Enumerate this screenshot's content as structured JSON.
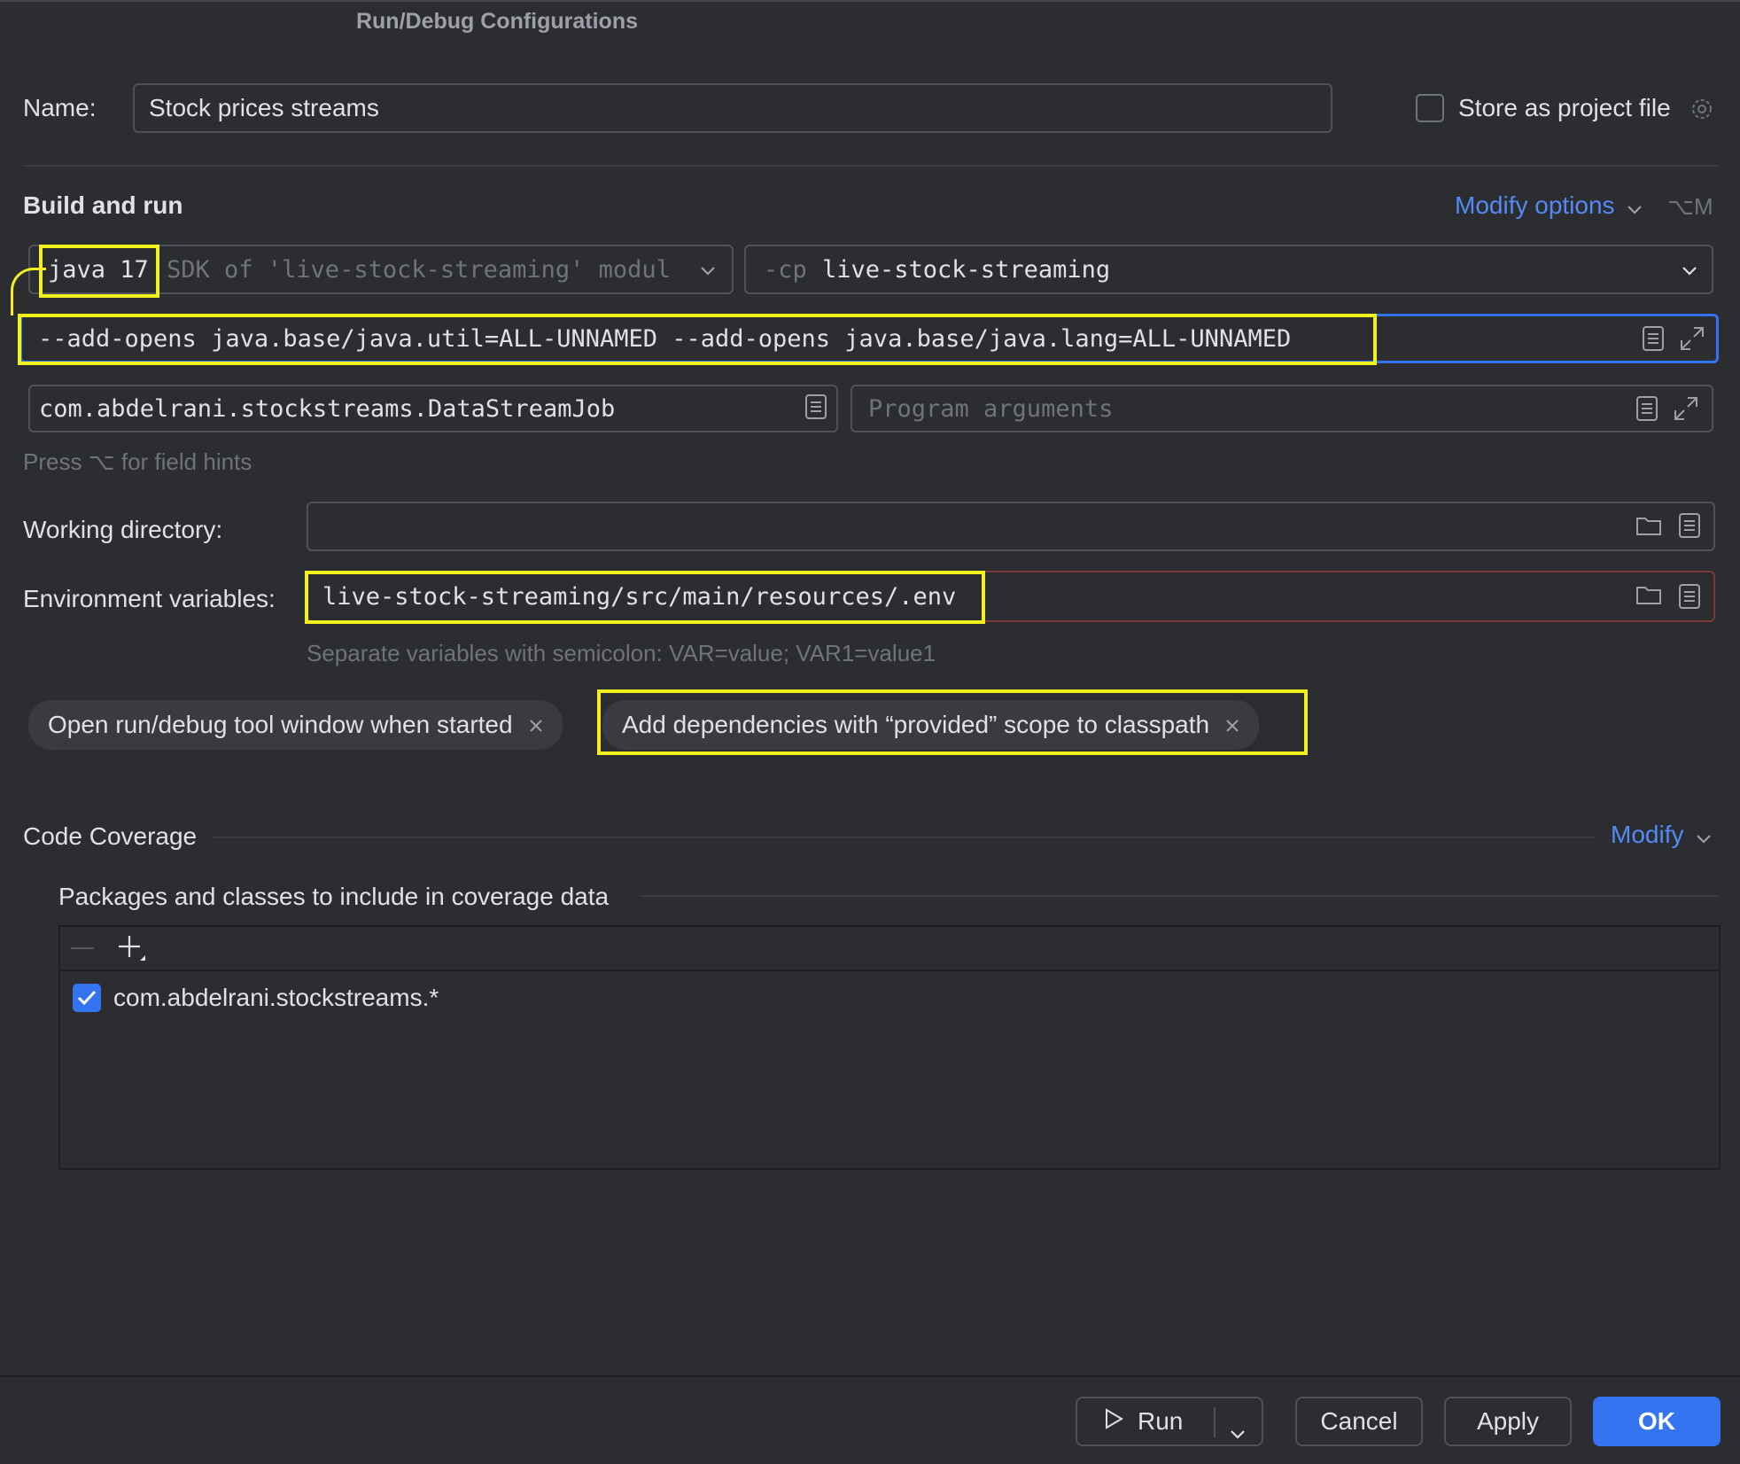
{
  "window": {
    "title": "Run/Debug Configurations"
  },
  "name_row": {
    "label": "Name:",
    "value": "Stock prices streams",
    "store_label": "Store as project file",
    "store_checked": false
  },
  "build": {
    "heading": "Build and run",
    "modify_options": "Modify options",
    "modify_shortcut": "⌥M",
    "jdk_value": "java 17",
    "jdk_hint": "SDK of 'live-stock-streaming' modul",
    "cp_prefix": "-cp",
    "cp_value": "live-stock-streaming",
    "vm_options": "--add-opens java.base/java.util=ALL-UNNAMED --add-opens java.base/java.lang=ALL-UNNAMED",
    "main_class": "com.abdelrani.stockstreams.DataStreamJob",
    "program_args_placeholder": "Program arguments",
    "hint": "Press ⌥ for field hints"
  },
  "working_dir": {
    "label": "Working directory:",
    "value": ""
  },
  "env": {
    "label": "Environment variables:",
    "value": "live-stock-streaming/src/main/resources/.env",
    "hint": "Separate variables with semicolon: VAR=value; VAR1=value1"
  },
  "chips": [
    {
      "label": "Open run/debug tool window when started"
    },
    {
      "label": "Add dependencies with “provided” scope to classpath"
    }
  ],
  "coverage": {
    "heading": "Code Coverage",
    "modify": "Modify",
    "packages_label": "Packages and classes to include in coverage data",
    "items": [
      {
        "label": "com.abdelrani.stockstreams.*",
        "checked": true
      }
    ]
  },
  "footer": {
    "run": "Run",
    "cancel": "Cancel",
    "apply": "Apply",
    "ok": "OK"
  },
  "colors": {
    "background": "#2b2d30",
    "accent": "#3574f0",
    "link": "#548af7",
    "highlight": "#f2f01f",
    "error_border": "#7a3a3a"
  }
}
